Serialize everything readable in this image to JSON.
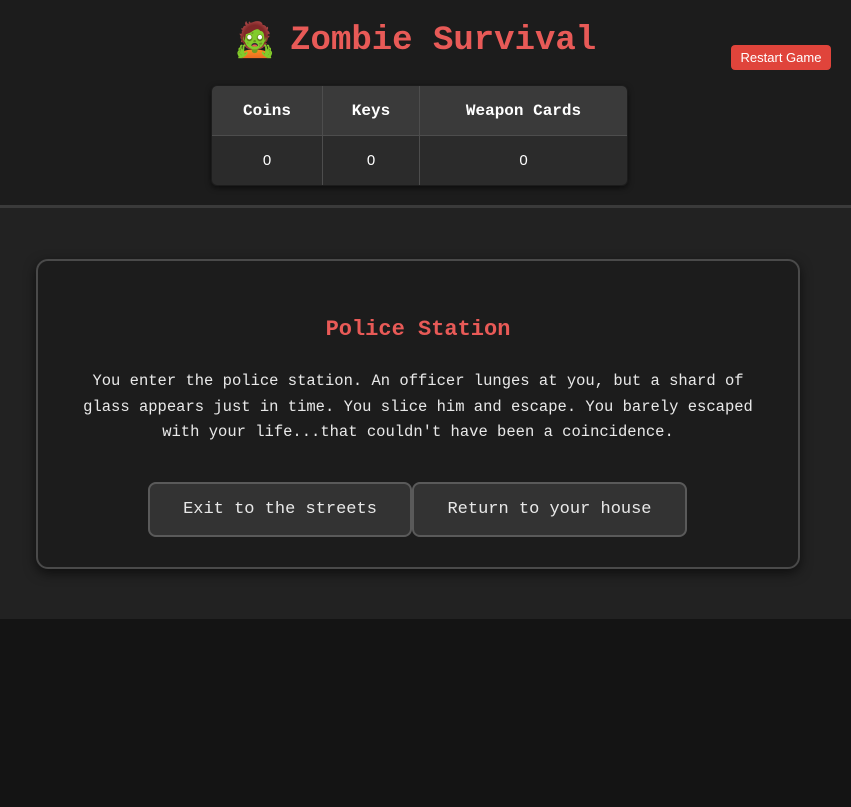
{
  "header": {
    "icon": "🧟",
    "title": "Zombie Survival",
    "restart_label": "Restart Game"
  },
  "stats": {
    "columns": [
      "Coins",
      "Keys",
      "Weapon Cards"
    ],
    "values": [
      "0",
      "0",
      "0"
    ]
  },
  "scene": {
    "location": "Police Station",
    "text": "You enter the police station. An officer lunges at you, but a shard of glass appears just in time. You slice him and escape. You barely escaped with your life...that couldn't have been a coincidence.",
    "choices": [
      "Exit to the streets",
      "Return to your house"
    ]
  },
  "colors": {
    "accent": "#e85a57",
    "restart_button": "#e0443b",
    "background": "#141414"
  }
}
